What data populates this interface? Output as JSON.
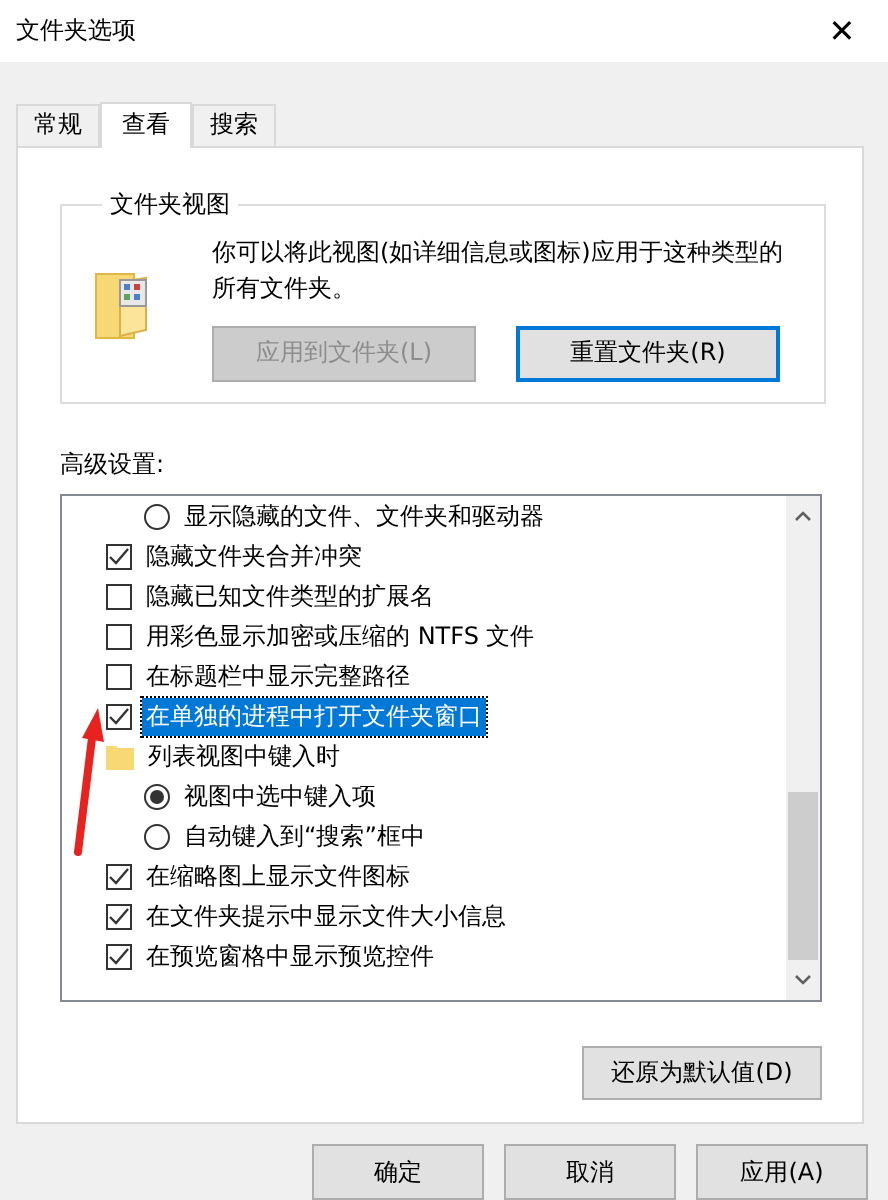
{
  "window": {
    "title": "文件夹选项",
    "close": "✕"
  },
  "tabs": [
    {
      "label": "常规",
      "selected": false
    },
    {
      "label": "查看",
      "selected": true
    },
    {
      "label": "搜索",
      "selected": false
    }
  ],
  "folder_views": {
    "title": "文件夹视图",
    "description": "你可以将此视图(如详细信息或图标)应用于这种类型的所有文件夹。",
    "buttons": [
      {
        "label": "应用到文件夹(L)",
        "disabled": true,
        "focused": false
      },
      {
        "label": "重置文件夹(R)",
        "disabled": false,
        "focused": true
      }
    ]
  },
  "advanced": {
    "label": "高级设置:",
    "items": [
      {
        "kind": "radio",
        "label": "显示隐藏的文件、文件夹和驱动器",
        "checked": false,
        "selected": false
      },
      {
        "kind": "checkbox",
        "label": "隐藏文件夹合并冲突",
        "checked": true,
        "selected": false
      },
      {
        "kind": "checkbox",
        "label": "隐藏已知文件类型的扩展名",
        "checked": false,
        "selected": false
      },
      {
        "kind": "checkbox",
        "label": "用彩色显示加密或压缩的 NTFS 文件",
        "checked": false,
        "selected": false
      },
      {
        "kind": "checkbox",
        "label": "在标题栏中显示完整路径",
        "checked": false,
        "selected": false
      },
      {
        "kind": "checkbox",
        "label": "在单独的进程中打开文件夹窗口",
        "checked": true,
        "selected": true
      },
      {
        "kind": "folder",
        "label": "列表视图中键入时",
        "selected": false
      },
      {
        "kind": "radio",
        "label": "视图中选中键入项",
        "checked": true,
        "selected": false
      },
      {
        "kind": "radio",
        "label": "自动键入到“搜索”框中",
        "checked": false,
        "selected": false
      },
      {
        "kind": "checkbox",
        "label": "在缩略图上显示文件图标",
        "checked": true,
        "selected": false
      },
      {
        "kind": "checkbox",
        "label": "在文件夹提示中显示文件大小信息",
        "checked": true,
        "selected": false
      },
      {
        "kind": "checkbox",
        "label": "在预览窗格中显示预览控件",
        "checked": true,
        "selected": false
      }
    ],
    "restore_button": "还原为默认值(D)"
  },
  "buttons": [
    "确定",
    "取消",
    "应用(A)"
  ]
}
